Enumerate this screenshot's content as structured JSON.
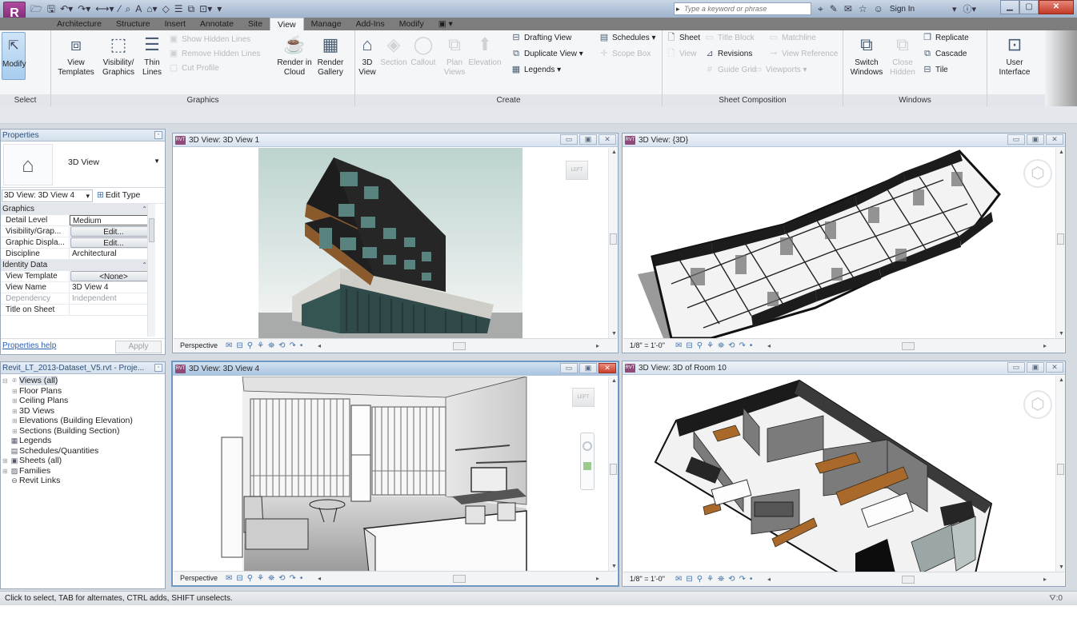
{
  "app": {
    "logo_letter": "R",
    "quick_access": [
      "open-icon",
      "save-icon",
      "undo-icon",
      "redo-icon",
      "measure-icon",
      "dimension-icon",
      "tag-icon",
      "text-icon",
      "3d-view-icon",
      "section-icon",
      "thin-lines-icon",
      "close-hidden-icon",
      "switch-windows-icon",
      "customize-icon"
    ],
    "search_placeholder": "Type a keyword or phrase",
    "sign_in": "Sign In",
    "help": "?"
  },
  "ribbon": {
    "tabs": [
      {
        "label": "Architecture",
        "active": false
      },
      {
        "label": "Structure",
        "active": false
      },
      {
        "label": "Insert",
        "active": false
      },
      {
        "label": "Annotate",
        "active": false
      },
      {
        "label": "Site",
        "active": false
      },
      {
        "label": "View",
        "active": true
      },
      {
        "label": "Manage",
        "active": false
      },
      {
        "label": "Add-Ins",
        "active": false
      },
      {
        "label": "Modify",
        "active": false
      },
      {
        "label": "▣ ▾",
        "active": false
      }
    ],
    "panels": {
      "select": {
        "title": "Select",
        "modify": "Modify"
      },
      "graphics": {
        "title": "Graphics",
        "view_templates": "View Templates",
        "visibility_graphics": "Visibility/ Graphics",
        "thin_lines": "Thin Lines",
        "show_hidden_lines": "Show  Hidden Lines",
        "remove_hidden_lines": "Remove  Hidden Lines",
        "cut_profile": "Cut  Profile",
        "render_in_cloud": "Render in Cloud",
        "render_gallery": "Render Gallery"
      },
      "create": {
        "title": "Create",
        "view_3d": "3D View",
        "section": "Section",
        "callout": "Callout",
        "plan_views": "Plan Views",
        "elevation": "Elevation",
        "drafting_view": "Drafting  View",
        "duplicate_view": "Duplicate  View",
        "legends": "Legends",
        "schedules": "Schedules",
        "scope_box": "Scope  Box"
      },
      "sheet_composition": {
        "title": "Sheet Composition",
        "sheet": "Sheet",
        "view": "View",
        "title_block": "Title  Block",
        "revisions": "Revisions",
        "guide_grid": "Guide  Grid",
        "matchline": "Matchline",
        "view_reference": "View  Reference",
        "viewports": "Viewports"
      },
      "windows": {
        "title": "Windows",
        "switch_windows": "Switch Windows",
        "close_hidden": "Close Hidden",
        "replicate": "Replicate",
        "cascade": "Cascade",
        "tile": "Tile"
      },
      "user_interface": {
        "label": "User Interface"
      }
    }
  },
  "properties": {
    "title": "Properties",
    "type_name": "3D View",
    "instance_selector": "3D View: 3D View 4",
    "edit_type": "Edit Type",
    "groups": [
      {
        "name": "Graphics",
        "rows": [
          {
            "key": "Detail Level",
            "value": "Medium",
            "kind": "boxed"
          },
          {
            "key": "Visibility/Grap...",
            "value": "Edit...",
            "kind": "button"
          },
          {
            "key": "Graphic Displa...",
            "value": "Edit...",
            "kind": "button"
          },
          {
            "key": "Discipline",
            "value": "Architectural",
            "kind": "text"
          }
        ]
      },
      {
        "name": "Identity Data",
        "rows": [
          {
            "key": "View Template",
            "value": "<None>",
            "kind": "button"
          },
          {
            "key": "View Name",
            "value": "3D View 4",
            "kind": "text"
          },
          {
            "key": "Dependency",
            "value": "Independent",
            "kind": "dim"
          },
          {
            "key": "Title on Sheet",
            "value": "",
            "kind": "text"
          }
        ]
      }
    ],
    "help_link": "Properties help",
    "apply": "Apply"
  },
  "project_browser": {
    "title": "Revit_LT_2013-Dataset_V5.rvt - Proje...",
    "items": [
      {
        "label": "Views (all)",
        "level": 0,
        "expander": "⊟",
        "icon": "⌾",
        "selected": true
      },
      {
        "label": "Floor Plans",
        "level": 1,
        "expander": "⊞",
        "icon": "",
        "selected": false
      },
      {
        "label": "Ceiling Plans",
        "level": 1,
        "expander": "⊞",
        "icon": "",
        "selected": false
      },
      {
        "label": "3D Views",
        "level": 1,
        "expander": "⊞",
        "icon": "",
        "selected": false
      },
      {
        "label": "Elevations (Building Elevation)",
        "level": 1,
        "expander": "⊞",
        "icon": "",
        "selected": false
      },
      {
        "label": "Sections (Building Section)",
        "level": 1,
        "expander": "⊞",
        "icon": "",
        "selected": false
      },
      {
        "label": "Legends",
        "level": 0,
        "expander": "",
        "icon": "▦",
        "selected": false
      },
      {
        "label": "Schedules/Quantities",
        "level": 0,
        "expander": "",
        "icon": "▤",
        "selected": false
      },
      {
        "label": "Sheets (all)",
        "level": 0,
        "expander": "⊞",
        "icon": "▣",
        "selected": false
      },
      {
        "label": "Families",
        "level": 0,
        "expander": "⊞",
        "icon": "▨",
        "selected": false
      },
      {
        "label": "Revit Links",
        "level": 0,
        "expander": "",
        "icon": "⊖",
        "selected": false
      }
    ]
  },
  "views": [
    {
      "title": "3D View: 3D View 1",
      "scale": "Perspective",
      "active": false,
      "kind": "exterior"
    },
    {
      "title": "3D View: {3D}",
      "scale": "1/8\" = 1'-0\"",
      "active": false,
      "kind": "plan3d"
    },
    {
      "title": "3D View: 3D View 4",
      "scale": "Perspective",
      "active": true,
      "kind": "interior"
    },
    {
      "title": "3D View: 3D of Room 10",
      "scale": "1/8\" = 1'-0\"",
      "active": false,
      "kind": "room"
    }
  ],
  "view_controls": {
    "minimize": "▭",
    "restore": "▣",
    "close": "✕",
    "view_bar_icons": [
      "✉",
      "⊟",
      "⚲",
      "⚘",
      "⛯",
      "⟲",
      "↷",
      "•",
      "◂"
    ]
  },
  "status": {
    "message": "Click to select, TAB for alternates, CTRL adds, SHIFT unselects.",
    "filter_count": ":0"
  },
  "colors": {
    "accent": "#6f97c4",
    "brand": "#8e4a79",
    "sky": "#c2d5d1",
    "glass": "#4f7c78",
    "wood": "#b06f2f"
  }
}
